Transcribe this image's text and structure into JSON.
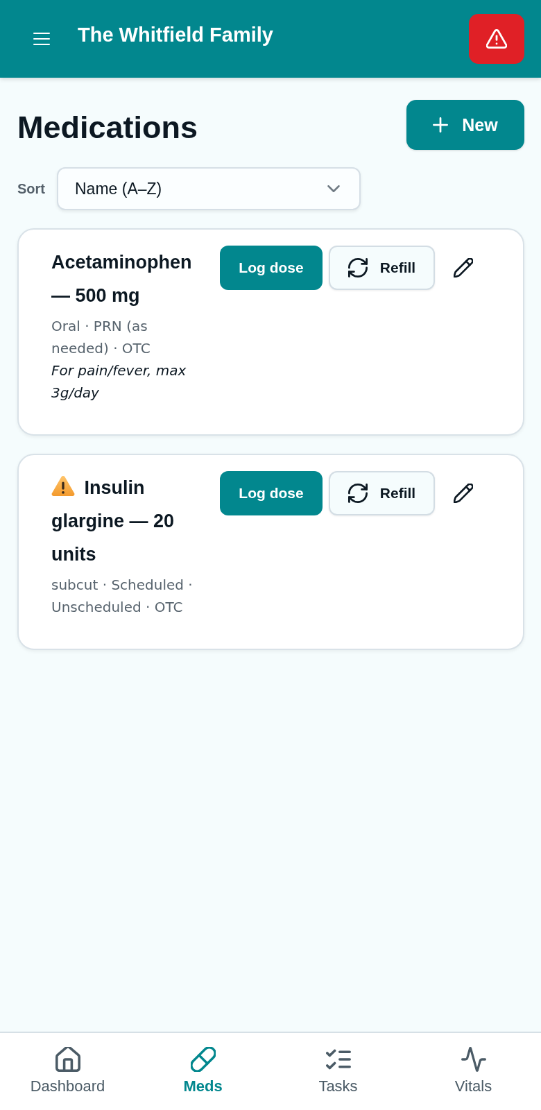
{
  "header": {
    "title": "The Whitfield Family"
  },
  "page": {
    "title": "Medications",
    "new_label": "New"
  },
  "sort": {
    "label": "Sort",
    "value": "Name (A–Z)"
  },
  "medications": [
    {
      "name": "Acetaminophen — 500 mg",
      "alert": false,
      "details": "Oral · PRN (as needed) · OTC",
      "note": "For pain/fever, max 3g/day",
      "log_label": "Log dose",
      "refill_label": "Refill"
    },
    {
      "name": "Insulin glargine — 20 units",
      "alert": true,
      "details": "subcut · Scheduled · Unscheduled · OTC",
      "log_label": "Log dose",
      "refill_label": "Refill"
    }
  ],
  "nav": [
    {
      "label": "Dashboard",
      "kind": "dashboard",
      "selected": false
    },
    {
      "label": "Meds",
      "kind": "meds",
      "selected": true
    },
    {
      "label": "Tasks",
      "kind": "tasks",
      "selected": false
    },
    {
      "label": "Vitals",
      "kind": "vitals",
      "selected": false
    }
  ]
}
